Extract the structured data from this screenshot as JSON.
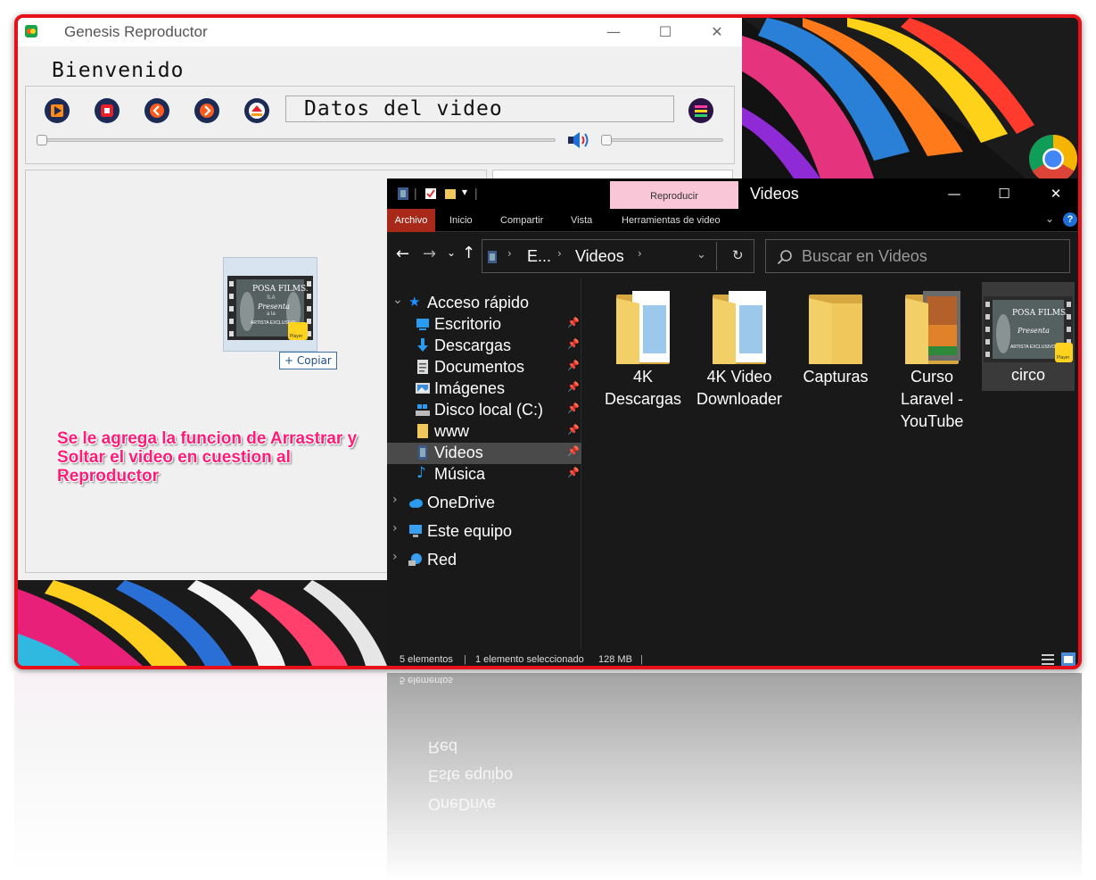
{
  "player": {
    "title": "Genesis Reproductor",
    "welcome": "Bienvenido",
    "video_info": "Datos del video",
    "controls": [
      "play-icon",
      "stop-icon",
      "previous-icon",
      "next-icon",
      "eject-icon"
    ],
    "menu_icon": "menu-icon",
    "window_controls": {
      "minimize": "—",
      "maximize": "☐",
      "close": "✕"
    },
    "drag": {
      "copy_label": "+ Copiar"
    },
    "annotation": "Se le agrega la funcion de Arrastrar y Soltar el video en cuestion al Reproductor"
  },
  "explorer": {
    "title": "Videos",
    "context_tab": "Reproducir",
    "ribbon_tabs": [
      "Archivo",
      "Inicio",
      "Compartir",
      "Vista",
      "Herramientas de video"
    ],
    "address": {
      "segments": [
        "E...",
        "Videos"
      ]
    },
    "search_placeholder": "Buscar en Videos",
    "window_controls": {
      "minimize": "—",
      "maximize": "☐",
      "close": "✕"
    },
    "nav": {
      "quick_access": "Acceso rápido",
      "pinned": [
        {
          "label": "Escritorio",
          "icon": "desktop-icon"
        },
        {
          "label": "Descargas",
          "icon": "download-icon"
        },
        {
          "label": "Documentos",
          "icon": "document-icon"
        },
        {
          "label": "Imágenes",
          "icon": "image-icon"
        },
        {
          "label": "Disco local (C:)",
          "icon": "drive-icon"
        },
        {
          "label": "www",
          "icon": "folder-icon"
        },
        {
          "label": "Videos",
          "icon": "video-icon",
          "selected": true
        },
        {
          "label": "Música",
          "icon": "music-icon"
        }
      ],
      "onedrive": "OneDrive",
      "this_pc": "Este equipo",
      "network": "Red"
    },
    "files": [
      {
        "label": "4K Descargas",
        "type": "folder"
      },
      {
        "label": "4K Video Downloader",
        "type": "folder"
      },
      {
        "label": "Capturas",
        "type": "folder"
      },
      {
        "label": "Curso Laravel - YouTube",
        "type": "folder"
      },
      {
        "label": "circo",
        "type": "video",
        "selected": true
      }
    ],
    "status": {
      "count": "5 elementos",
      "selection": "1 elemento seleccionado",
      "size": "128 MB"
    }
  },
  "thumbnail": {
    "title": "POSA FILMS.",
    "sub": "S.A",
    "line1": "Presenta",
    "line2": "a la",
    "line3": "ARTISTA EXCLUSIVO",
    "badge": "Player"
  },
  "colors": {
    "frame_border": "#e8101b",
    "annotation": "#ff1b76",
    "archivo_tab": "#a8281a",
    "reproducir_tab": "#f8c6d6"
  }
}
